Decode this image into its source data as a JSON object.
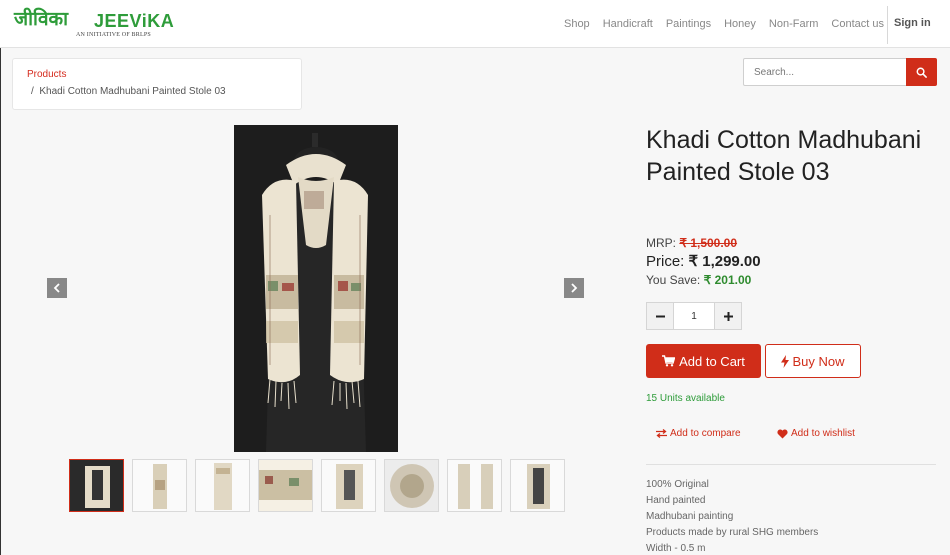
{
  "brand": {
    "name_hindi": "जीविका",
    "name_en": "JEEViKA",
    "tagline": "AN INITIATIVE OF BRLPS",
    "color": "#2e9c3a"
  },
  "nav": {
    "links": [
      "Shop",
      "Handicraft",
      "Paintings",
      "Honey",
      "Non-Farm",
      "Contact us"
    ],
    "signin": "Sign in"
  },
  "breadcrumb": {
    "parent": "Products",
    "current": "Khadi Cotton Madhubani Painted Stole 03",
    "separator": "/"
  },
  "search": {
    "placeholder": "Search...",
    "button_icon": "search-icon"
  },
  "gallery": {
    "prev_icon": "chevron-left-icon",
    "next_icon": "chevron-right-icon",
    "thumbnail_count": 8,
    "active_thumbnail": 1
  },
  "product": {
    "title": "Khadi Cotton Madhubani Painted Stole 03",
    "mrp_label": "MRP:",
    "mrp_value": "₹ 1,500.00",
    "price_label": "Price:",
    "price_value": "₹ 1,299.00",
    "save_label": "You Save:",
    "save_value": "₹ 201.00",
    "quantity": "1",
    "add_to_cart": "Add to Cart",
    "buy_now": "Buy Now",
    "availability": "15 Units available",
    "compare": "Add to compare",
    "wishlist": "Add to wishlist",
    "features": [
      "100% Original",
      "Hand painted",
      "Madhubani painting",
      "Products made by rural SHG members",
      "Width - 0.5 m"
    ]
  },
  "colors": {
    "accent": "#d02d19",
    "brand_green": "#2e9c3a",
    "save_green": "#2e8b2e"
  }
}
